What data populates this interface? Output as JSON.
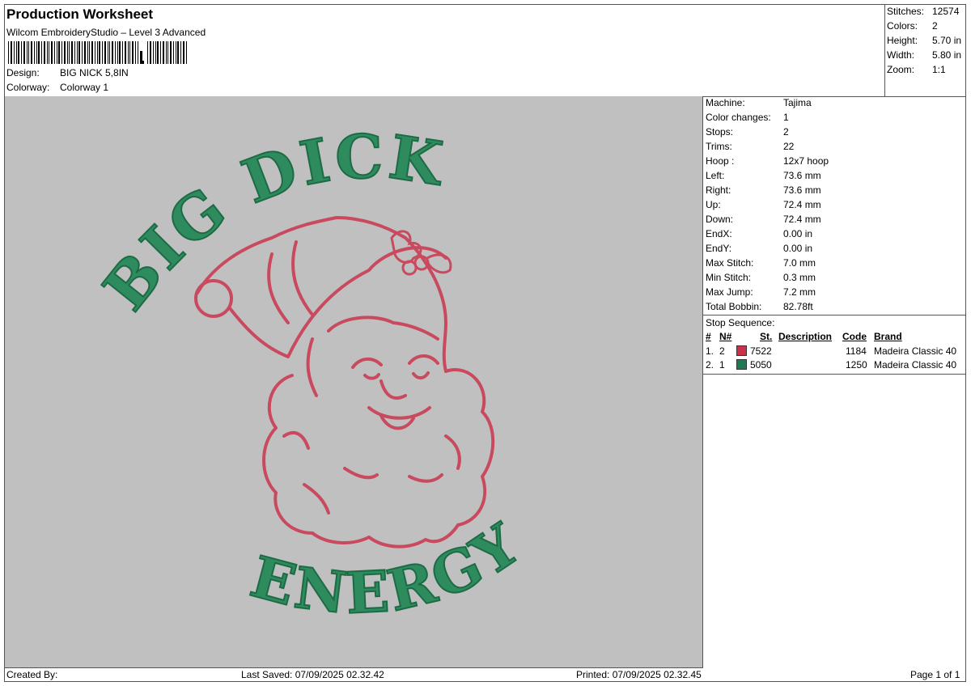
{
  "header": {
    "title": "Production Worksheet",
    "subtitle": "Wilcom EmbroideryStudio – Level 3 Advanced",
    "design_label": "Design:",
    "design_value": "BIG NICK 5,8IN",
    "colorway_label": "Colorway:",
    "colorway_value": "Colorway 1"
  },
  "stats": [
    {
      "label": "Stitches:",
      "value": "12574"
    },
    {
      "label": "Colors:",
      "value": "2"
    },
    {
      "label": "Height:",
      "value": "5.70 in"
    },
    {
      "label": "Width:",
      "value": "5.80 in"
    },
    {
      "label": "Zoom:",
      "value": "1:1"
    }
  ],
  "preview": {
    "text_top": "BIG DICK",
    "text_bottom": "ENERGY",
    "thread_red": "#c94a5e",
    "thread_green": "#2e8b5e",
    "background": "#c0c0c0"
  },
  "info": [
    {
      "label": "Machine:",
      "value": "Tajima"
    },
    {
      "label": "Color changes:",
      "value": "1"
    },
    {
      "label": "Stops:",
      "value": "2"
    },
    {
      "label": "Trims:",
      "value": "22"
    },
    {
      "label": "Hoop :",
      "value": "12x7 hoop"
    },
    {
      "label": "Left:",
      "value": "73.6 mm"
    },
    {
      "label": "Right:",
      "value": "73.6 mm"
    },
    {
      "label": "Up:",
      "value": "72.4 mm"
    },
    {
      "label": "Down:",
      "value": "72.4 mm"
    },
    {
      "label": "EndX:",
      "value": "0.00 in"
    },
    {
      "label": "EndY:",
      "value": "0.00 in"
    },
    {
      "label": "Max Stitch:",
      "value": "7.0 mm"
    },
    {
      "label": "Min Stitch:",
      "value": "0.3 mm"
    },
    {
      "label": "Max Jump:",
      "value": "7.2 mm"
    },
    {
      "label": "Total Bobbin:",
      "value": "82.78ft"
    }
  ],
  "stop_sequence": {
    "title": "Stop Sequence:",
    "columns": {
      "num": "#",
      "n": "N#",
      "st": "St.",
      "description": "Description",
      "code": "Code",
      "brand": "Brand"
    },
    "rows": [
      {
        "num": "1.",
        "n": "2",
        "color": "#c8324a",
        "st": "7522",
        "description": "",
        "code": "1184",
        "brand": "Madeira Classic 40"
      },
      {
        "num": "2.",
        "n": "1",
        "color": "#1e7a52",
        "st": "5050",
        "description": "",
        "code": "1250",
        "brand": "Madeira Classic 40"
      }
    ]
  },
  "footer": {
    "created_by": "Created By:",
    "last_saved": "Last Saved: 07/09/2025 02.32.42",
    "printed": "Printed: 07/09/2025 02.32.45",
    "page": "Page 1 of 1"
  }
}
